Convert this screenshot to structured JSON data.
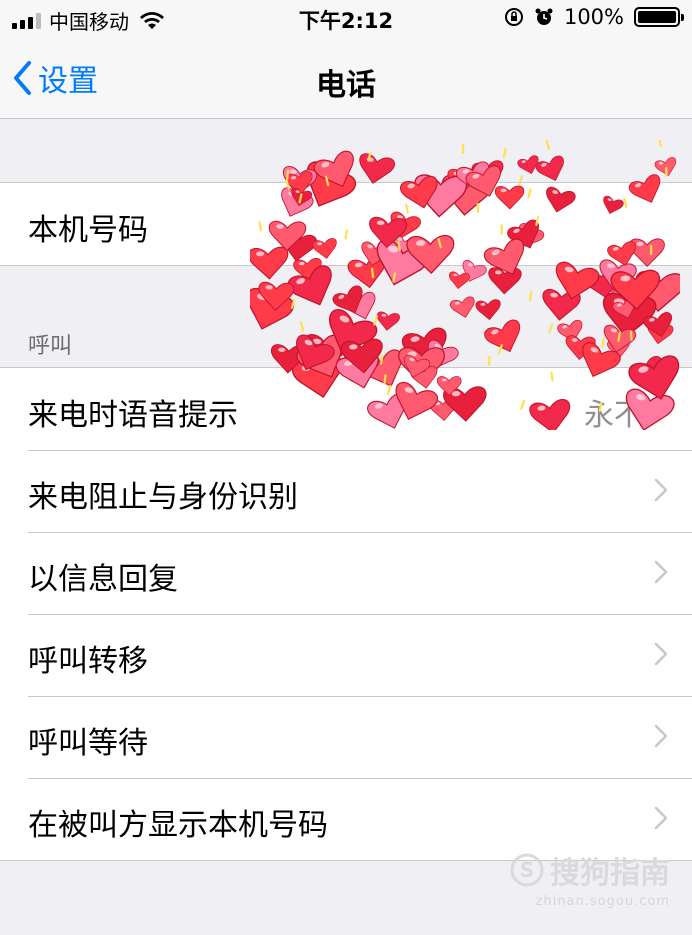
{
  "status": {
    "carrier": "中国移动",
    "time": "下午2:12",
    "battery": "100%",
    "icons": [
      "signal-icon",
      "wifi-icon",
      "orientation-lock-icon",
      "alarm-icon",
      "battery-icon"
    ]
  },
  "nav": {
    "back_label": "设置",
    "title": "电话"
  },
  "my_number": {
    "label": "本机号码"
  },
  "calls_section": {
    "header": "呼叫",
    "rows": [
      {
        "label": "来电时语音提示",
        "value": "永不"
      },
      {
        "label": "来电阻止与身份识别"
      },
      {
        "label": "以信息回复"
      },
      {
        "label": "呼叫转移"
      },
      {
        "label": "呼叫等待"
      },
      {
        "label": "在被叫方显示本机号码"
      }
    ]
  },
  "watermark": {
    "brand": "搜狗指南",
    "url": "zhinan.sogou.com"
  },
  "colors": {
    "accent": "#007aff",
    "background": "#efeff4",
    "heart": "#ff3b4a"
  }
}
